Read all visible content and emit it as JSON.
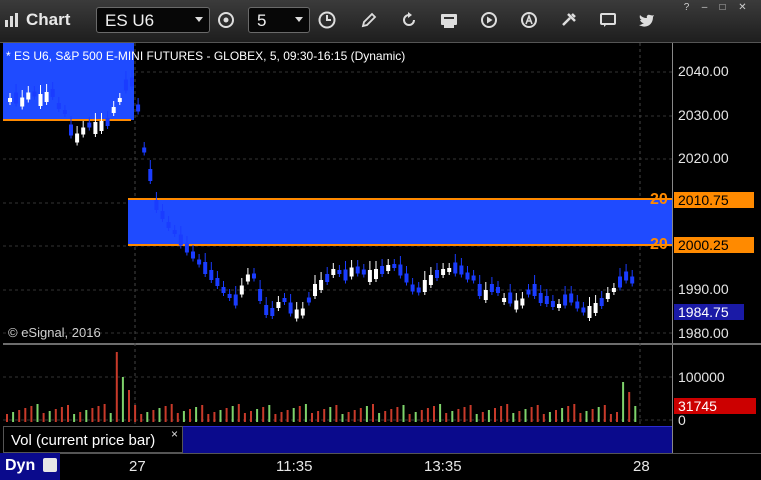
{
  "app": {
    "title": "Chart"
  },
  "toolbar": {
    "symbol": "ES U6",
    "interval": "5",
    "buttons": [
      "target-icon",
      "clock-icon",
      "pencil-icon",
      "refresh-icon",
      "get-icon",
      "play-icon",
      "alert-icon",
      "tools-icon",
      "chat-icon",
      "twitter-icon"
    ]
  },
  "window_controls": [
    "help",
    "minimize",
    "maximize",
    "close"
  ],
  "chart": {
    "title": "* ES U6, S&P 500 E-MINI FUTURES - GLOBEX, 5, 09:30-16:15 (Dynamic)",
    "copyright": "© eSignal, 2016",
    "price_axis_labels": [
      "2040.00",
      "2030.00",
      "2020.00",
      "1990.00",
      "1980.00"
    ],
    "current_price": "1984.75",
    "level_upper": "2010.75",
    "level_lower": "2000.25",
    "level_upper_tag": "20",
    "level_lower_tag": "20",
    "volume_axis_labels": [
      "100000",
      "0"
    ],
    "current_volume": "31745",
    "volume_study_label": "Vol (current price bar)",
    "time_labels": [
      "27",
      "11:35",
      "13:35",
      "28"
    ],
    "interval_mode": "Dyn",
    "colors": {
      "up": "#ffffff",
      "down": "#1a3cff",
      "zone": "#1f4bff",
      "level": "#ff8a00",
      "price_tag": "#1a1aa6",
      "vol_tag": "#cc0000",
      "vol_up": "#7ed36b",
      "vol_down": "#c83a2a"
    }
  }
}
